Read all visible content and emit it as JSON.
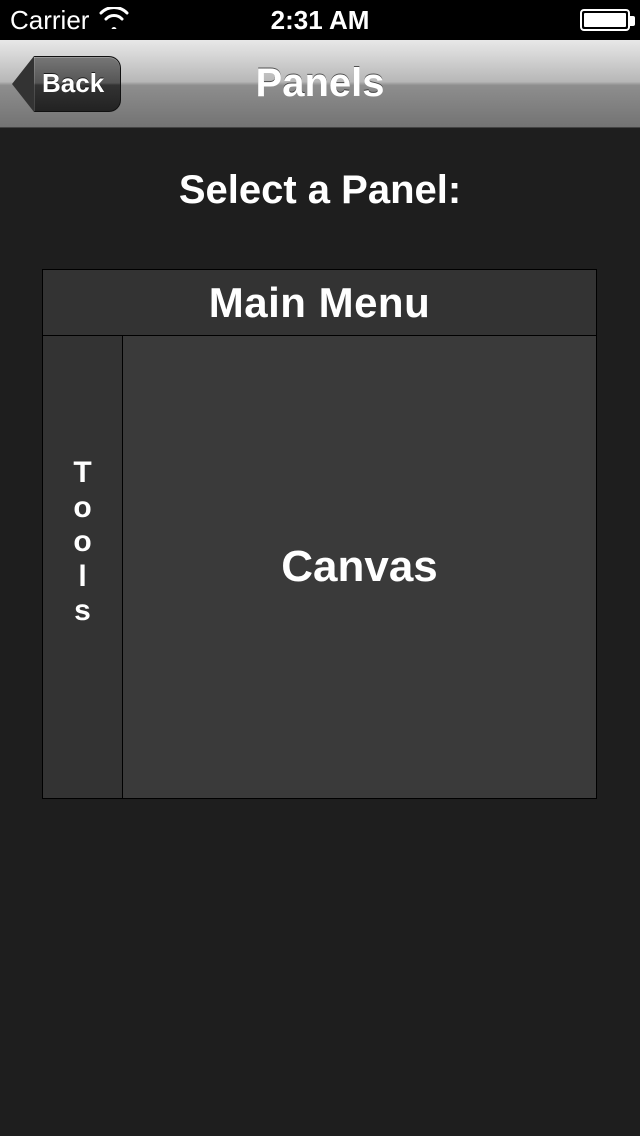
{
  "status": {
    "carrier": "Carrier",
    "time": "2:31 AM"
  },
  "nav": {
    "back_label": "Back",
    "title": "Panels"
  },
  "prompt": "Select a Panel:",
  "panels": {
    "main_menu": "Main Menu",
    "tools_vertical": "T\no\no\nl\ns",
    "canvas": "Canvas"
  }
}
